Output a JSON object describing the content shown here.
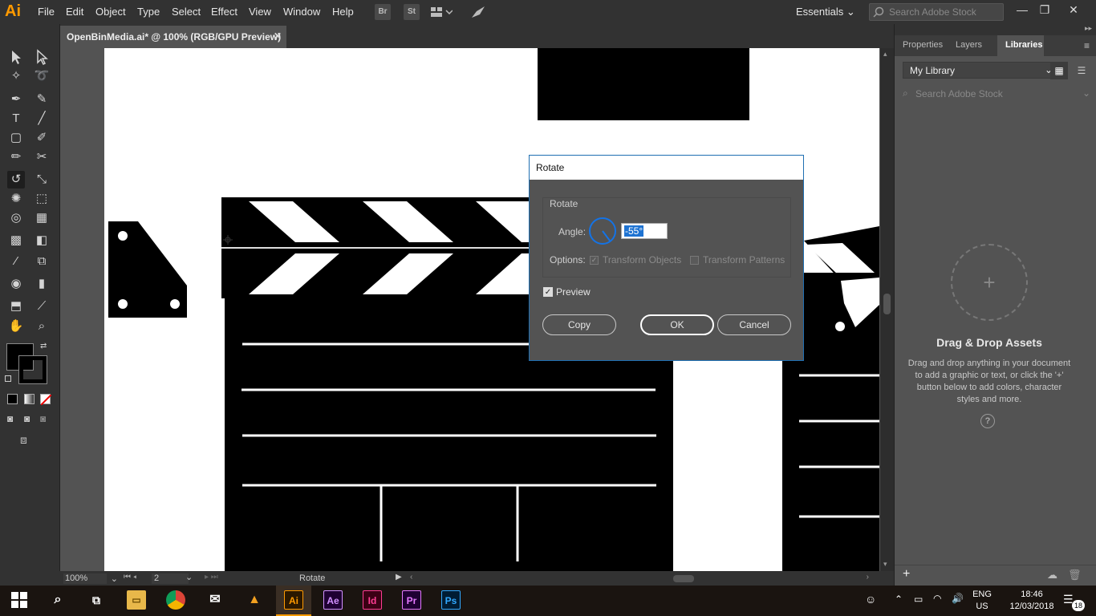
{
  "app": {
    "logo": "Ai",
    "accent": "#ff9a00"
  },
  "menu": [
    "File",
    "Edit",
    "Object",
    "Type",
    "Select",
    "Effect",
    "View",
    "Window",
    "Help"
  ],
  "bridge_icons": [
    "Br",
    "St"
  ],
  "workspace": "Essentials",
  "stock_search": {
    "placeholder": "Search Adobe Stock"
  },
  "document_tab": {
    "title": "OpenBinMedia.ai* @ 100% (RGB/GPU Preview)",
    "close": "✕"
  },
  "status": {
    "zoom": "100%",
    "artboard": "2",
    "tool": "Rotate"
  },
  "panel": {
    "tabs": [
      "Properties",
      "Layers",
      "Libraries"
    ],
    "library_select": "My Library",
    "search_placeholder": "Search Adobe Stock",
    "plus": "+",
    "drop_title": "Drag & Drop Assets",
    "drop_text": "Drag and drop anything in your document to add a graphic or text, or click the '+' button below to add colors, character styles and more.",
    "help": "?"
  },
  "dialog": {
    "title": "Rotate",
    "group_label": "Rotate",
    "angle_label": "Angle:",
    "angle_value": "-55°",
    "options_label": "Options:",
    "transform_objects": "Transform Objects",
    "transform_patterns": "Transform Patterns",
    "preview_label": "Preview",
    "copy_button": "Copy",
    "ok_button": "OK",
    "cancel_button": "Cancel",
    "preview_checked": true,
    "transform_objects_checked": true,
    "transform_patterns_checked": false
  },
  "taskbar": {
    "apps": [
      "Ai",
      "Ae",
      "Id",
      "Pr",
      "Ps"
    ],
    "lang": "ENG",
    "region": "US",
    "time": "18:46",
    "date": "12/03/2018",
    "notifications": "18"
  }
}
